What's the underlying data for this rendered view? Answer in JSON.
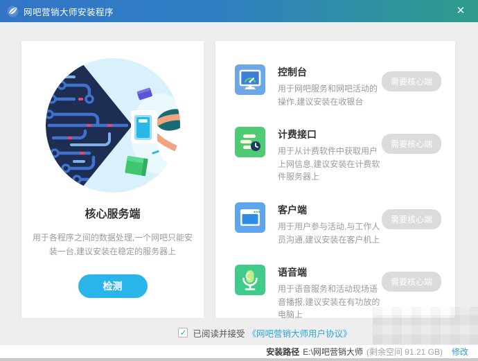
{
  "window": {
    "title": "网吧营销大师安装程序",
    "close_glyph": "✕"
  },
  "left_panel": {
    "title": "核心服务端",
    "description": "用于各程序之间的数据处理,一个网吧只能安装一台,建议安装在稳定的服务器上",
    "button_label": "检测"
  },
  "right_panel": {
    "items": [
      {
        "name": "控制台",
        "description": "用于网吧服务和网吧活动的操作,建议安装在收银台",
        "badge": "需要核心端",
        "icon": "console-monitor-icon",
        "icon_color": "#6CA7E9"
      },
      {
        "name": "计费接口",
        "description": "用于从计费软件中获取用户上网信息,建议安装在计费软件服务器上",
        "badge": "需要核心端",
        "icon": "billing-list-icon",
        "icon_color": "#4FCB76"
      },
      {
        "name": "客户端",
        "description": "用于用户参与活动,与工作人员沟通,建议安装在客户机上",
        "badge": "需要核心端",
        "icon": "client-window-icon",
        "icon_color": "#5FA5EE"
      },
      {
        "name": "语音端",
        "description": "用于语音服务和活动现场语音播报,建议安装在有功放的电脑上",
        "badge": "需要核心端",
        "icon": "voice-mic-icon",
        "icon_color": "#41CB8B"
      }
    ]
  },
  "agreement": {
    "checked": true,
    "check_glyph": "✓",
    "text": "已阅读并接受",
    "link": "《网吧营销大师用户协议》"
  },
  "footer": {
    "path_label": "安装路径",
    "path_value": "E:\\网吧营销大师",
    "free_space": "(剩余空间 91.21 GB)",
    "modify_label": "修改"
  },
  "colors": {
    "titlebar_left": "#3374C6",
    "titlebar_right": "#2F9C8C",
    "accent": "#29B4EA",
    "link": "#2BA7E0",
    "badge_bg": "#DBDBDB",
    "text_gray": "#9B9B9B"
  }
}
